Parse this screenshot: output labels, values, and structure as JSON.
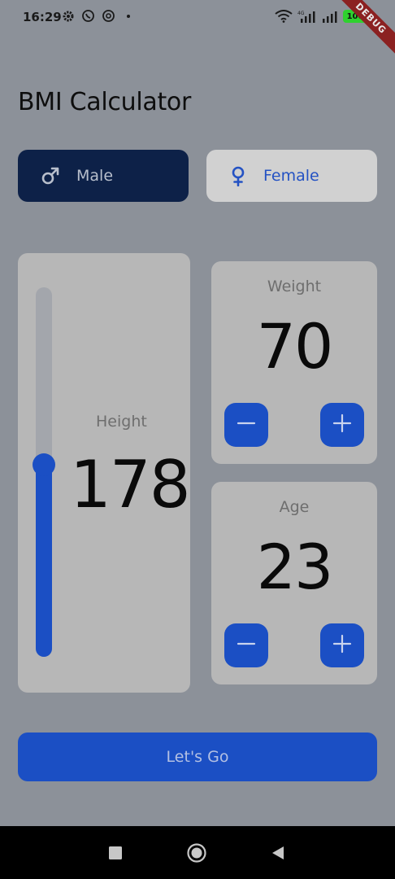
{
  "status_bar": {
    "time": "16:29",
    "battery": "100",
    "network_label": "4G"
  },
  "debug_banner": "DEBUG",
  "app": {
    "title": "BMI Calculator"
  },
  "gender": {
    "male_label": "Male",
    "female_label": "Female",
    "selected": "Male"
  },
  "height": {
    "label": "Height",
    "value": "178",
    "slider_fraction": 0.52
  },
  "weight": {
    "label": "Weight",
    "value": "70"
  },
  "age": {
    "label": "Age",
    "value": "23"
  },
  "action": {
    "button_label": "Let's Go"
  },
  "colors": {
    "accent": "#1b4fc4",
    "selected_gender_bg": "#0d2148",
    "card_bg": "#b7b7b7",
    "page_bg": "#8c9199"
  },
  "icons": {
    "male": "male-symbol-icon",
    "female": "female-symbol-icon",
    "decrement": "minus-icon",
    "increment": "plus-icon"
  }
}
